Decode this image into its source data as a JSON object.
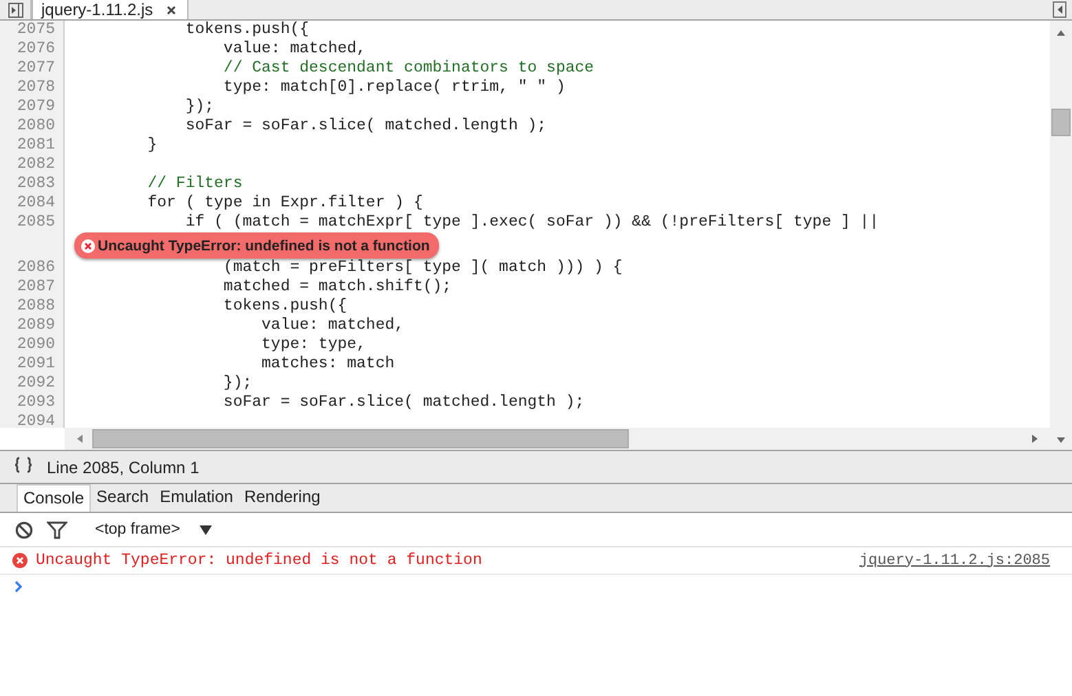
{
  "tabs": [
    {
      "label": "jquery-1.11.2.js",
      "selected": true
    }
  ],
  "editor": {
    "lines": [
      {
        "kind": "code",
        "number": "2075",
        "text": "            tokens.push({"
      },
      {
        "kind": "code",
        "number": "2076",
        "text": "                value: matched,"
      },
      {
        "kind": "comment",
        "number": "2077",
        "text": "                // Cast descendant combinators to space"
      },
      {
        "kind": "code",
        "number": "2078",
        "text": "                type: match[0].replace( rtrim, \" \" )"
      },
      {
        "kind": "code",
        "number": "2079",
        "text": "            });"
      },
      {
        "kind": "code",
        "number": "2080",
        "text": "            soFar = soFar.slice( matched.length );"
      },
      {
        "kind": "code",
        "number": "2081",
        "text": "        }"
      },
      {
        "kind": "code",
        "number": "2082"
      },
      {
        "kind": "comment",
        "number": "2083",
        "text": "        // Filters"
      },
      {
        "kind": "code",
        "number": "2084",
        "text": "        for ( type in Expr.filter ) {"
      },
      {
        "kind": "code",
        "number": "2085",
        "text": "            if ( (match = matchExpr[ type ].exec( soFar )) && (!preFilters[ type ] ||"
      },
      {
        "kind": "error",
        "text": "Uncaught TypeError: undefined is not a function"
      },
      {
        "kind": "code",
        "number": "2086",
        "text": "                (match = preFilters[ type ]( match ))) ) {"
      },
      {
        "kind": "code",
        "number": "2087",
        "text": "                matched = match.shift();"
      },
      {
        "kind": "code",
        "number": "2088",
        "text": "                tokens.push({"
      },
      {
        "kind": "code",
        "number": "2089",
        "text": "                    value: matched,"
      },
      {
        "kind": "code",
        "number": "2090",
        "text": "                    type: type,"
      },
      {
        "kind": "code",
        "number": "2091",
        "text": "                    matches: match"
      },
      {
        "kind": "code",
        "number": "2092",
        "text": "                });"
      },
      {
        "kind": "code",
        "number": "2093",
        "text": "                soFar = soFar.slice( matched.length );"
      },
      {
        "kind": "code",
        "number": "2094"
      }
    ]
  },
  "status_bar": {
    "position": "Line 2085, Column 1"
  },
  "drawer_tabs": [
    {
      "label": "Console",
      "selected": true
    },
    {
      "label": "Search",
      "selected": false
    },
    {
      "label": "Emulation",
      "selected": false
    },
    {
      "label": "Rendering",
      "selected": false
    }
  ],
  "console": {
    "frame_selector": "<top frame>",
    "messages": [
      {
        "kind": "error",
        "text": "Uncaught TypeError: undefined is not a function",
        "source": "jquery-1.11.2.js:2085"
      }
    ]
  }
}
